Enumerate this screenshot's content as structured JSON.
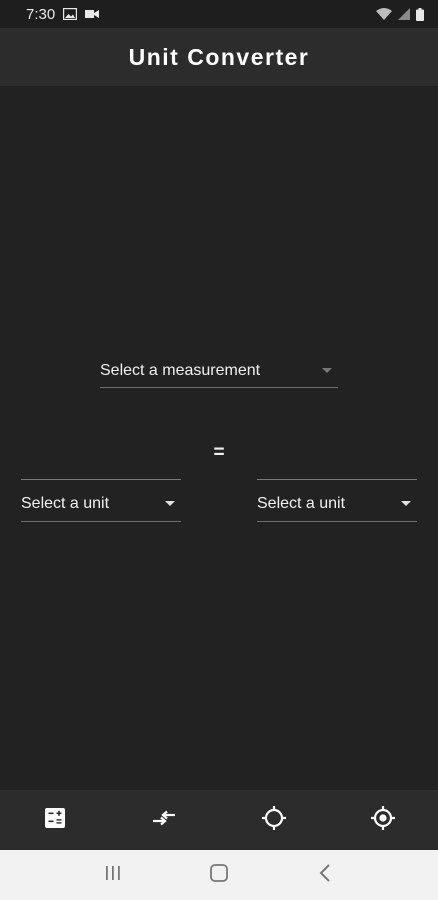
{
  "status_bar": {
    "time": "7:30",
    "left_icons": [
      "image-icon",
      "video-camera-icon"
    ],
    "right_icons": [
      "wifi-icon",
      "signal-icon",
      "battery-icon"
    ]
  },
  "app_bar": {
    "title": "Unit Converter"
  },
  "converter": {
    "measurement_placeholder": "Select a measurement",
    "equals_sign": "=",
    "from_unit_placeholder": "Select a unit",
    "to_unit_placeholder": "Select a unit",
    "from_value": "",
    "to_value": ""
  },
  "bottom_nav": {
    "items": [
      {
        "icon": "calculator-icon"
      },
      {
        "icon": "convert-arrows-icon"
      },
      {
        "icon": "crosshair-icon"
      },
      {
        "icon": "target-icon"
      }
    ]
  },
  "system_nav": {
    "items": [
      {
        "icon": "recents-icon"
      },
      {
        "icon": "home-icon"
      },
      {
        "icon": "back-icon"
      }
    ]
  },
  "colors": {
    "background": "#222222",
    "app_bar": "#2c2c2c",
    "text": "#ffffff",
    "divider": "#6f6f6f",
    "system_nav": "#f2f2f2"
  }
}
